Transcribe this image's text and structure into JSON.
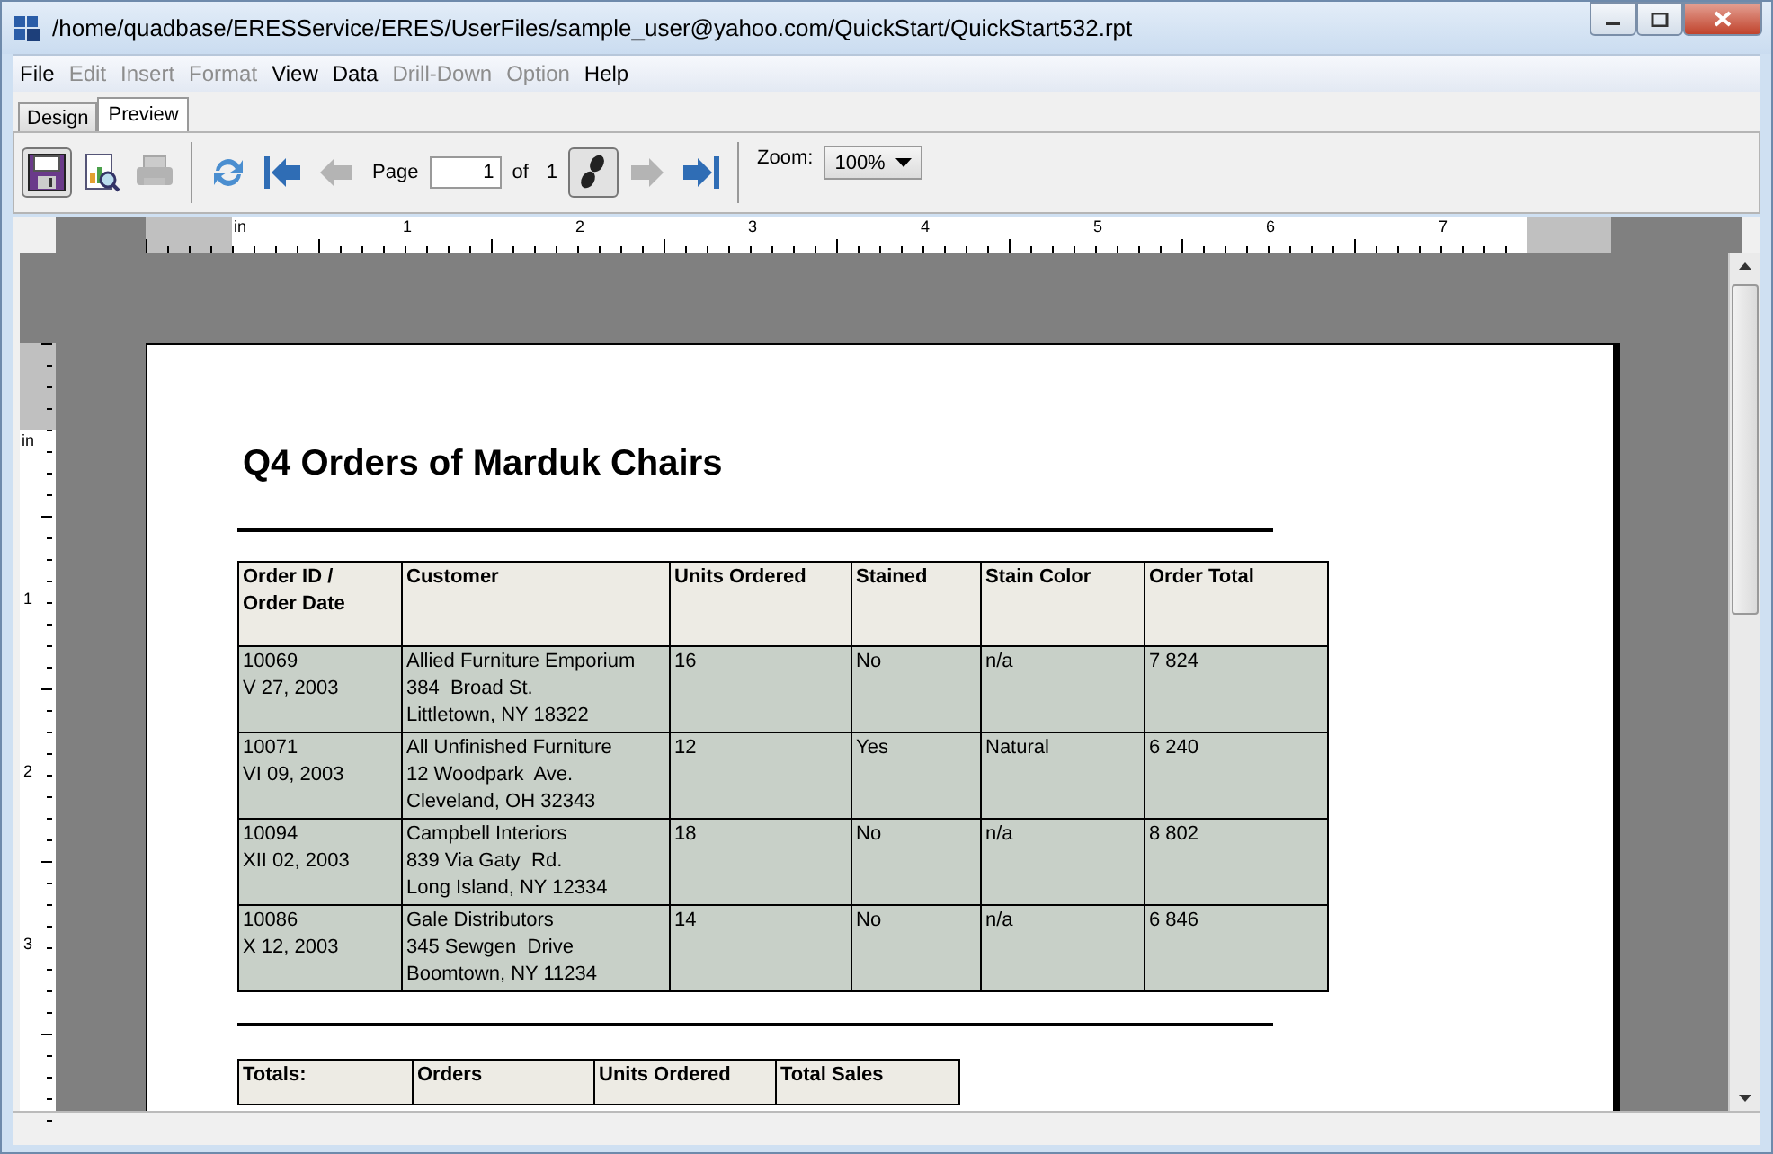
{
  "window": {
    "title": "/home/quadbase/ERESService/ERES/UserFiles/sample_user@yahoo.com/QuickStart/QuickStart532.rpt"
  },
  "menu": [
    {
      "label": "File",
      "disabled": false
    },
    {
      "label": "Edit",
      "disabled": true
    },
    {
      "label": "Insert",
      "disabled": true
    },
    {
      "label": "Format",
      "disabled": true
    },
    {
      "label": "View",
      "disabled": false
    },
    {
      "label": "Data",
      "disabled": false
    },
    {
      "label": "Drill-Down",
      "disabled": true
    },
    {
      "label": "Option",
      "disabled": true
    },
    {
      "label": "Help",
      "disabled": false
    }
  ],
  "tabs": [
    {
      "label": "Design",
      "selected": false
    },
    {
      "label": "Preview",
      "selected": true
    }
  ],
  "toolbar": {
    "buttons": [
      {
        "disabled": false,
        "pressed": true
      },
      {
        "disabled": false,
        "pressed": false
      },
      {
        "disabled": true,
        "pressed": false
      },
      {
        "disabled": false,
        "pressed": false
      },
      {
        "disabled": false,
        "pressed": false
      },
      {
        "disabled": true,
        "pressed": false
      }
    ],
    "page_label": "Page",
    "page_value": "1",
    "of_label": "of",
    "page_count": "1",
    "nav_buttons": [
      {
        "disabled": false,
        "pressed": true
      },
      {
        "disabled": true,
        "pressed": false
      },
      {
        "disabled": false,
        "pressed": false
      }
    ],
    "zoom_label": "Zoom:",
    "zoom_value": "100%"
  },
  "ruler": {
    "horizontal_unit": "in",
    "vertical_unit": "in",
    "horizontal_labels": [
      "1",
      "2",
      "3",
      "4",
      "5",
      "6",
      "7"
    ],
    "vertical_labels": [
      "1",
      "2",
      "3"
    ]
  },
  "report": {
    "title": "Q4 Orders of Marduk Chairs",
    "table": {
      "columns": [
        "Order ID /\nOrder Date",
        "Customer",
        "Units Ordered",
        "Stained",
        "Stain Color",
        "Order Total"
      ],
      "rows": [
        [
          "10069\nV 27, 2003",
          "Allied Furniture Emporium\n384  Broad St.\nLittletown, NY 18322",
          "16",
          "No",
          "n/a",
          "7 824"
        ],
        [
          "10071\nVI 09, 2003",
          "All Unfinished Furniture\n12 Woodpark  Ave.\nCleveland, OH 32343",
          "12",
          "Yes",
          "Natural",
          "6 240"
        ],
        [
          "10094\nXII 02, 2003",
          "Campbell Interiors\n839 Via Gaty  Rd.\nLong Island, NY 12334",
          "18",
          "No",
          "n/a",
          "8 802"
        ],
        [
          "10086\nX 12, 2003",
          "Gale Distributors\n345 Sewgen  Drive\nBoomtown, NY 11234",
          "14",
          "No",
          "n/a",
          "6 846"
        ]
      ]
    },
    "totals": {
      "columns": [
        "Totals:",
        "Orders",
        "Units Ordered",
        "Total Sales"
      ]
    }
  }
}
